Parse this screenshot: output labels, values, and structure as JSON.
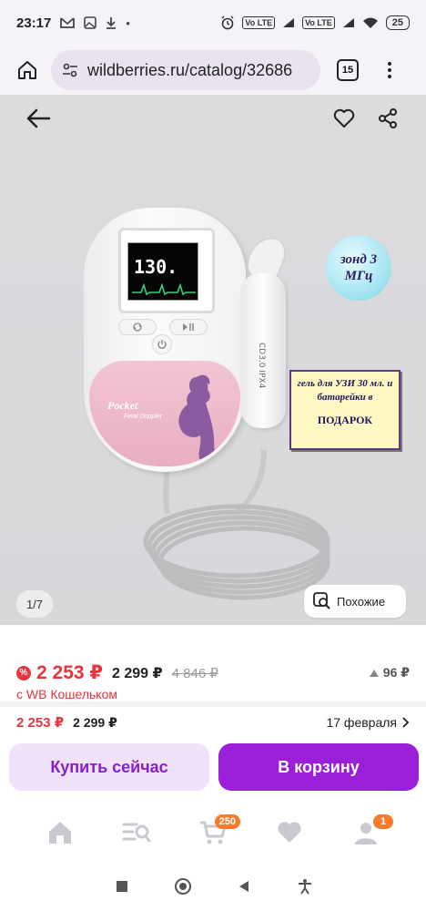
{
  "status_bar": {
    "time": "23:17",
    "battery": "25",
    "sim1": "Vo LTE",
    "sim2": "Vo LTE",
    "icons": [
      "gmail-icon",
      "photo-icon",
      "download-icon",
      "dot-icon",
      "alarm-icon",
      "signal-icon",
      "wifi-icon"
    ]
  },
  "browser": {
    "url": "wildberries.ru/catalog/32686",
    "tab_count": "15"
  },
  "gallery": {
    "counter": "1/7",
    "similar_label": "Похожие",
    "device_reading": "130.",
    "badge_probe": "зонд 3 МГц",
    "gift_text": "гель для УЗИ 30 мл. и батарейки в",
    "gift_word": "ПОДАРОК",
    "brand": "Pocket",
    "brand_sub": "Fetal Doppler",
    "probe_label": "CD3.0 IPX4"
  },
  "prices": {
    "wallet_price": "2 253 ₽",
    "price": "2 299 ₽",
    "old_price": "4 846 ₽",
    "price_drop": "96 ₽",
    "wallet_note": "с WB Кошельком",
    "row2_wallet_price": "2 253 ₽",
    "row2_price": "2 299 ₽",
    "delivery_date": "17 февраля"
  },
  "actions": {
    "buy_now": "Купить сейчас",
    "add_to_cart": "В корзину"
  },
  "bottom_nav": {
    "cart_badge": "250",
    "profile_badge": "1"
  },
  "colors": {
    "accent_purple": "#9b1fd9",
    "price_red": "#e8343d",
    "badge_orange": "#f57c2a"
  }
}
